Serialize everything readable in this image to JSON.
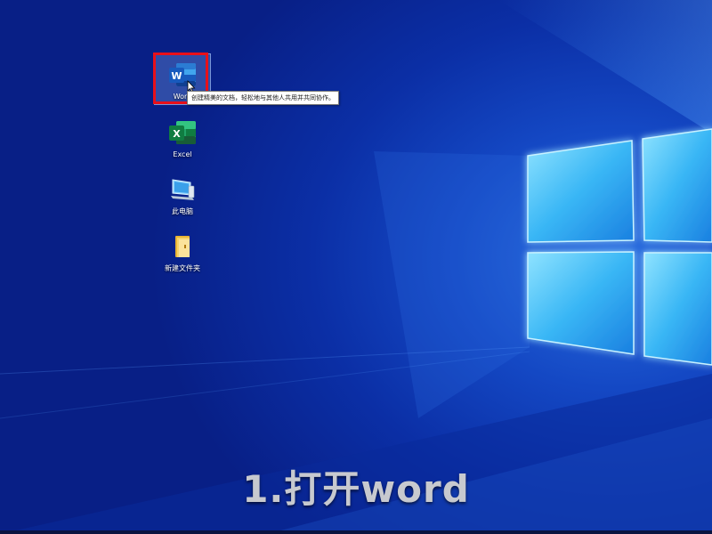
{
  "desktop": {
    "icons": [
      {
        "name": "word",
        "label": "Word",
        "icon": "word-icon",
        "selected": true
      },
      {
        "name": "excel",
        "label": "Excel",
        "icon": "excel-icon",
        "selected": false
      },
      {
        "name": "this-pc",
        "label": "此电脑",
        "icon": "computer-icon",
        "selected": false
      },
      {
        "name": "new-folder",
        "label": "新建文件夹",
        "icon": "folder-icon",
        "selected": false
      }
    ],
    "tooltip": "创建精美的文档，轻松地与其他人共用并共同协作。",
    "highlight_color": "#e8101a"
  },
  "caption": "1.打开word",
  "colors": {
    "word_blue": "#2b579a",
    "excel_green": "#217346",
    "folder_yellow": "#f3c74b",
    "wallpaper_blue": "#0b2fa6"
  }
}
